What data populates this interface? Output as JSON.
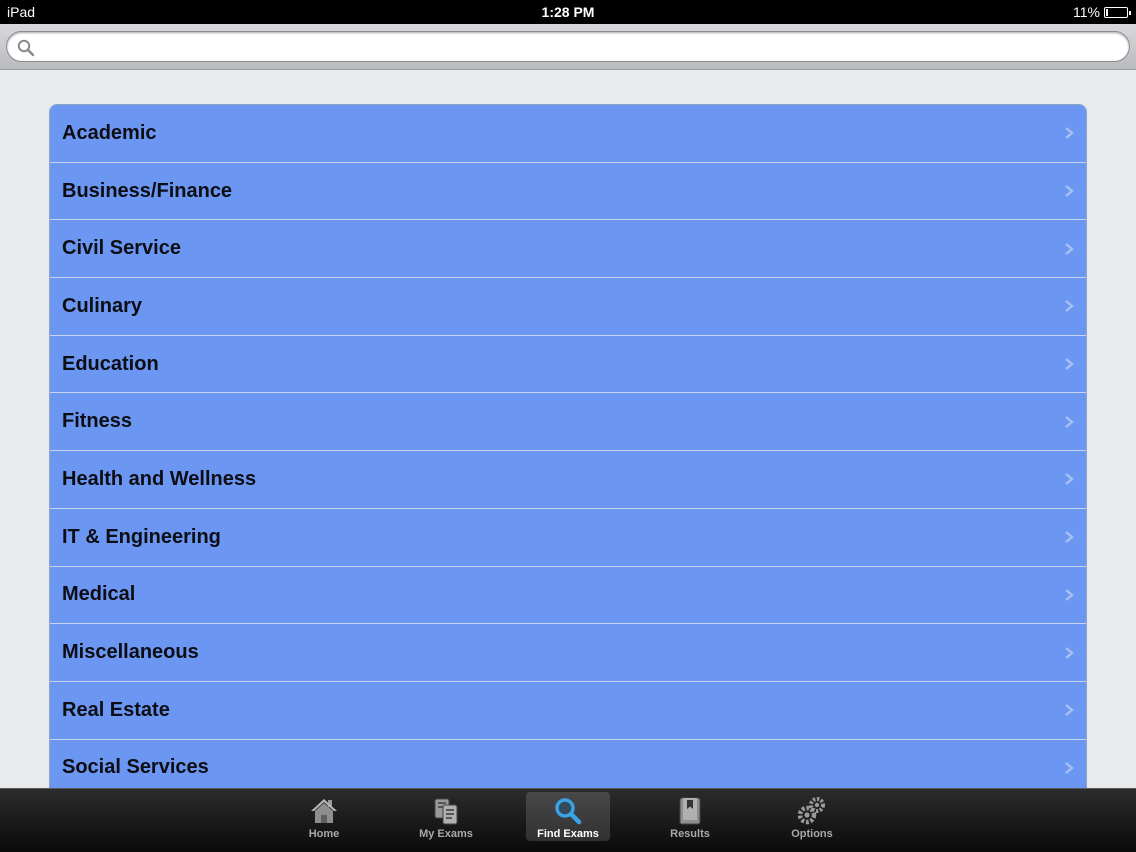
{
  "status_bar": {
    "device": "iPad",
    "time": "1:28 PM",
    "battery": "11%",
    "battery_level": 0.11
  },
  "search": {
    "placeholder": "",
    "value": ""
  },
  "categories": [
    {
      "label": "Academic"
    },
    {
      "label": "Business/Finance"
    },
    {
      "label": "Civil Service"
    },
    {
      "label": "Culinary"
    },
    {
      "label": "Education"
    },
    {
      "label": "Fitness"
    },
    {
      "label": "Health and Wellness"
    },
    {
      "label": "IT & Engineering"
    },
    {
      "label": "Medical"
    },
    {
      "label": "Miscellaneous"
    },
    {
      "label": "Real Estate"
    },
    {
      "label": "Social Services"
    }
  ],
  "tab_bar": {
    "tabs": [
      {
        "label": "Home",
        "icon": "home-icon"
      },
      {
        "label": "My Exams",
        "icon": "documents-icon"
      },
      {
        "label": "Find Exams",
        "icon": "magnifier-icon",
        "selected": true
      },
      {
        "label": "Results",
        "icon": "book-icon"
      },
      {
        "label": "Options",
        "icon": "gears-icon"
      }
    ]
  },
  "colors": {
    "row_bg": "#6b96f1",
    "accent": "#3aa3e8"
  }
}
